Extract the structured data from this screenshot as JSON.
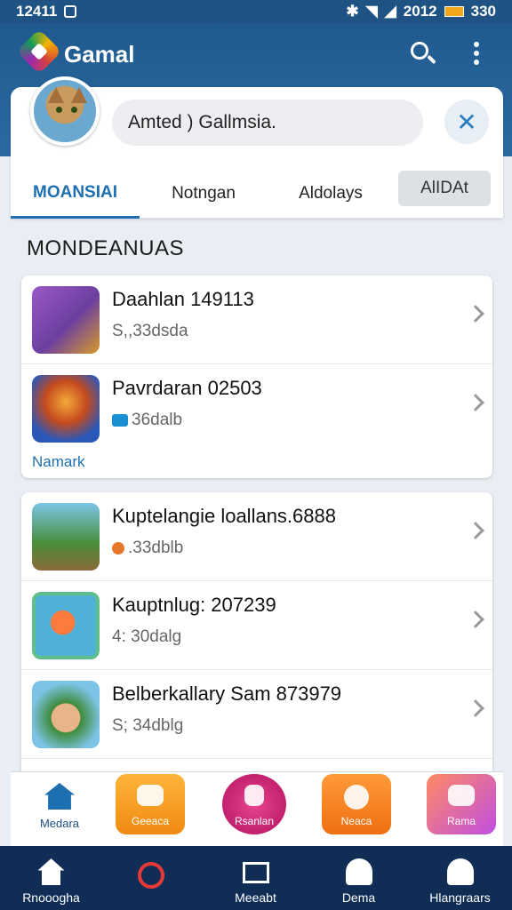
{
  "status_bar": {
    "time": "12411",
    "right_text": "2012",
    "battery_text": "330"
  },
  "app_bar": {
    "title": "Gamal"
  },
  "profile": {
    "name": "Amted ) Gallmsia."
  },
  "tabs": [
    {
      "label": "MOANSIAI",
      "active": true
    },
    {
      "label": "Notngan",
      "active": false
    },
    {
      "label": "Aldolays",
      "active": false
    },
    {
      "label": "AlIDAt",
      "active": false
    }
  ],
  "section": {
    "title": "MONDEANUAS"
  },
  "group1": {
    "rows": [
      {
        "title": "Daahlan 149113",
        "subtitle": "S,,33dsda",
        "thumb_color": "#6b3fa0"
      },
      {
        "title": "Pavrdaran 02503",
        "subtitle": "36dalb",
        "thumb_color": "#2a57b8"
      }
    ],
    "footer": "Namark"
  },
  "group2": {
    "rows": [
      {
        "title": "Kuptelangie loallans.6888",
        "subtitle": ".33dblb",
        "thumb_color": "#4a8d3a"
      },
      {
        "title": "Kauptnlug: 207239",
        "subtitle": "4: 30dalg",
        "thumb_color": "#4fb0d8"
      },
      {
        "title": "Belberkallary Sam 873979",
        "subtitle": "S; 34dblg",
        "thumb_color": "#3f8b3a"
      }
    ]
  },
  "dock": [
    {
      "label": "Medara",
      "color": "#1e6fb0"
    },
    {
      "label": "Geeaca",
      "color": "#f39a1e"
    },
    {
      "label": "Rsanlan",
      "color": "#d81b77"
    },
    {
      "label": "Neaca",
      "color": "#f28a17"
    },
    {
      "label": "Rama",
      "color": "#d25ab8"
    }
  ],
  "nav": [
    {
      "label": "Rnooogha"
    },
    {
      "label": ""
    },
    {
      "label": "Meeabt"
    },
    {
      "label": "Dema"
    },
    {
      "label": "Hlangraars"
    }
  ]
}
